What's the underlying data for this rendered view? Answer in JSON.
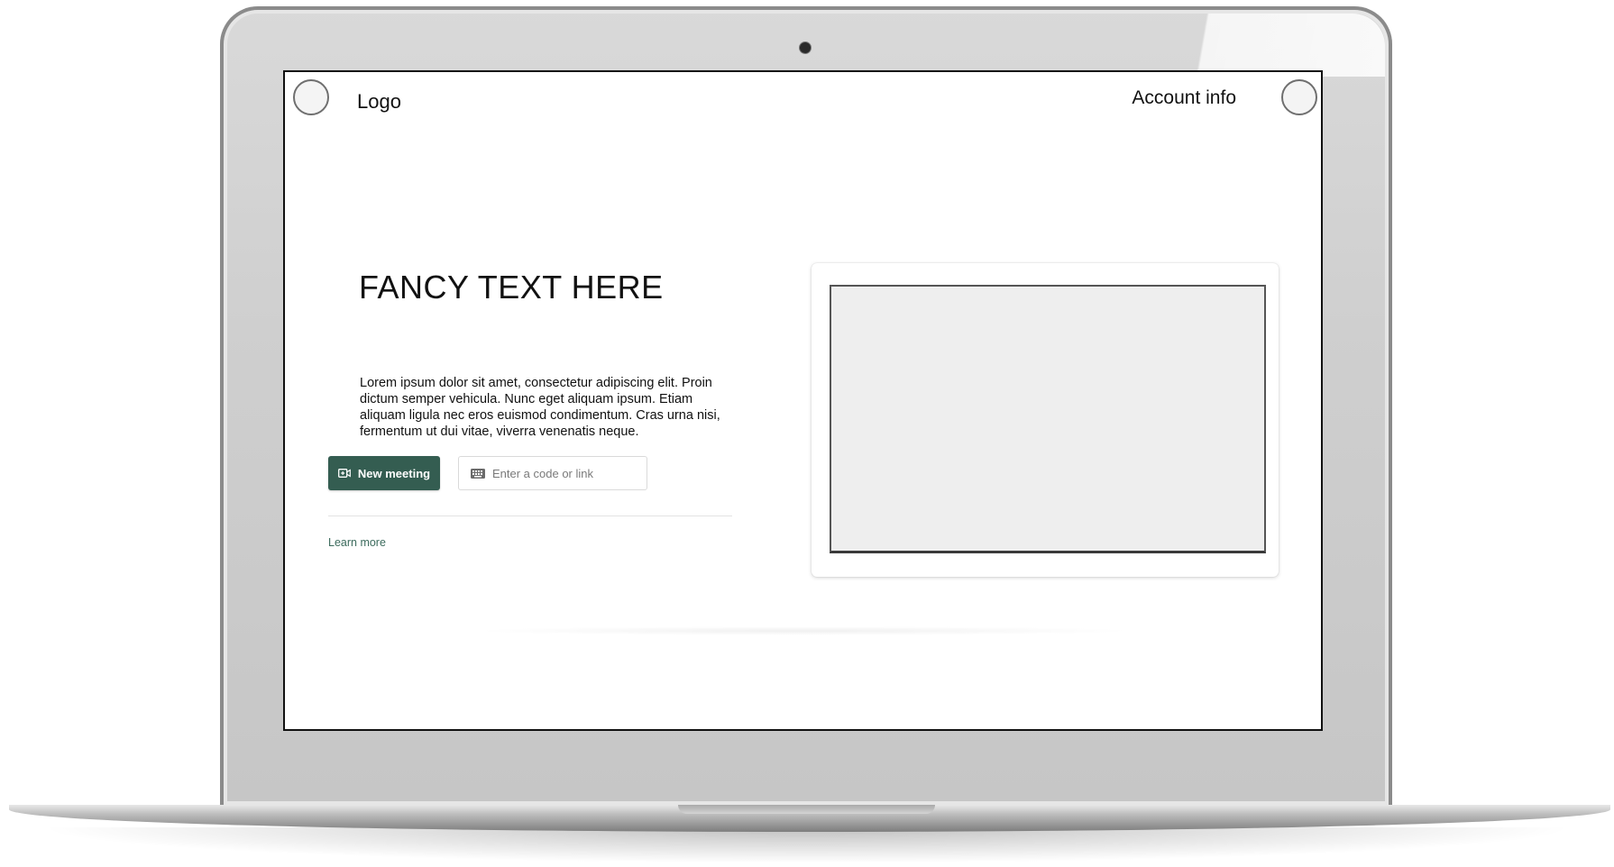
{
  "header": {
    "logo": "Logo",
    "account": "Account info"
  },
  "hero": {
    "title": "FANCY TEXT HERE",
    "body": "Lorem ipsum dolor sit amet, consectetur adipiscing elit. Proin dictum semper vehicula. Nunc eget aliquam ipsum. Etiam aliquam ligula nec eros euismod condimentum. Cras urna nisi, fermentum ut dui vitae, viverra venenatis neque.",
    "new_meeting_label": "New meeting",
    "code_placeholder": "Enter a code or link",
    "learn_more": "Learn more"
  },
  "icons": {
    "new_meeting": "video-plus-icon",
    "code_input": "keyboard-icon"
  },
  "colors": {
    "primary": "#345d51",
    "link": "#3c6b5d"
  }
}
